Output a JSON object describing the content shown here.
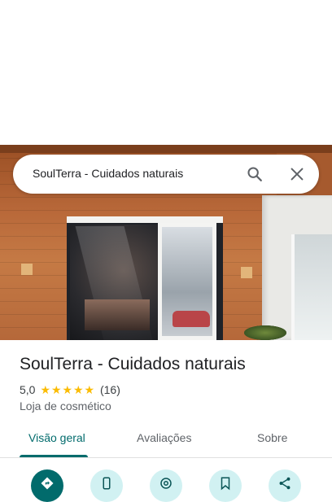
{
  "search": {
    "query": "SoulTerra - Cuidados naturais"
  },
  "place": {
    "name": "SoulTerra - Cuidados naturais",
    "rating": "5,0",
    "stars": 5,
    "review_count": "(16)",
    "category": "Loja de cosmético"
  },
  "tabs": [
    {
      "label": "Visão geral",
      "active": true
    },
    {
      "label": "Avaliações",
      "active": false
    },
    {
      "label": "Sobre",
      "active": false
    }
  ],
  "actions": [
    {
      "icon": "directions-icon"
    },
    {
      "icon": "phone-icon"
    },
    {
      "icon": "nearby-icon"
    },
    {
      "icon": "save-icon"
    },
    {
      "icon": "share-icon"
    }
  ],
  "colors": {
    "accent": "#016b6c",
    "accent_light": "#d1f1f2",
    "star": "#fbbc04"
  }
}
